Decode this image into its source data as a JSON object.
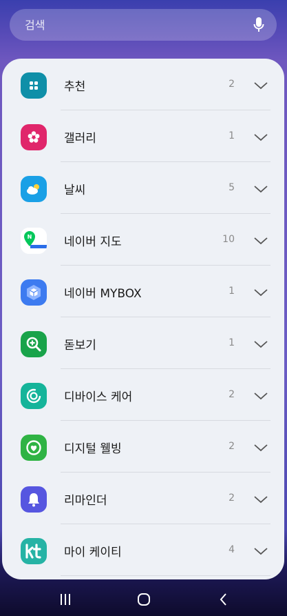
{
  "search": {
    "placeholder": "검색",
    "icon": "mic-icon"
  },
  "apps": [
    {
      "name": "추천",
      "count": "2",
      "icon": "recommend-icon",
      "color": "#0f8fa8"
    },
    {
      "name": "갤러리",
      "count": "1",
      "icon": "gallery-icon",
      "color": "#e0266b"
    },
    {
      "name": "날씨",
      "count": "5",
      "icon": "weather-icon",
      "color": "#1aa0e6"
    },
    {
      "name": "네이버 지도",
      "count": "10",
      "icon": "naver-map-icon",
      "color": "#ffffff"
    },
    {
      "name": "네이버 MYBOX",
      "count": "1",
      "icon": "mybox-icon",
      "color": "#3d7bf0"
    },
    {
      "name": "돋보기",
      "count": "1",
      "icon": "magnifier-icon",
      "color": "#19a34a"
    },
    {
      "name": "디바이스 케어",
      "count": "2",
      "icon": "device-care-icon",
      "color": "#15b49a"
    },
    {
      "name": "디지털 웰빙",
      "count": "2",
      "icon": "digital-wellbeing-icon",
      "color": "#2fb344"
    },
    {
      "name": "리마인더",
      "count": "2",
      "icon": "reminder-icon",
      "color": "#5656e0"
    },
    {
      "name": "마이 케이티",
      "count": "4",
      "icon": "kt-icon",
      "color": "#26b3a5"
    }
  ],
  "navbar": {
    "recents": "recents-icon",
    "home": "home-icon",
    "back": "back-icon"
  }
}
